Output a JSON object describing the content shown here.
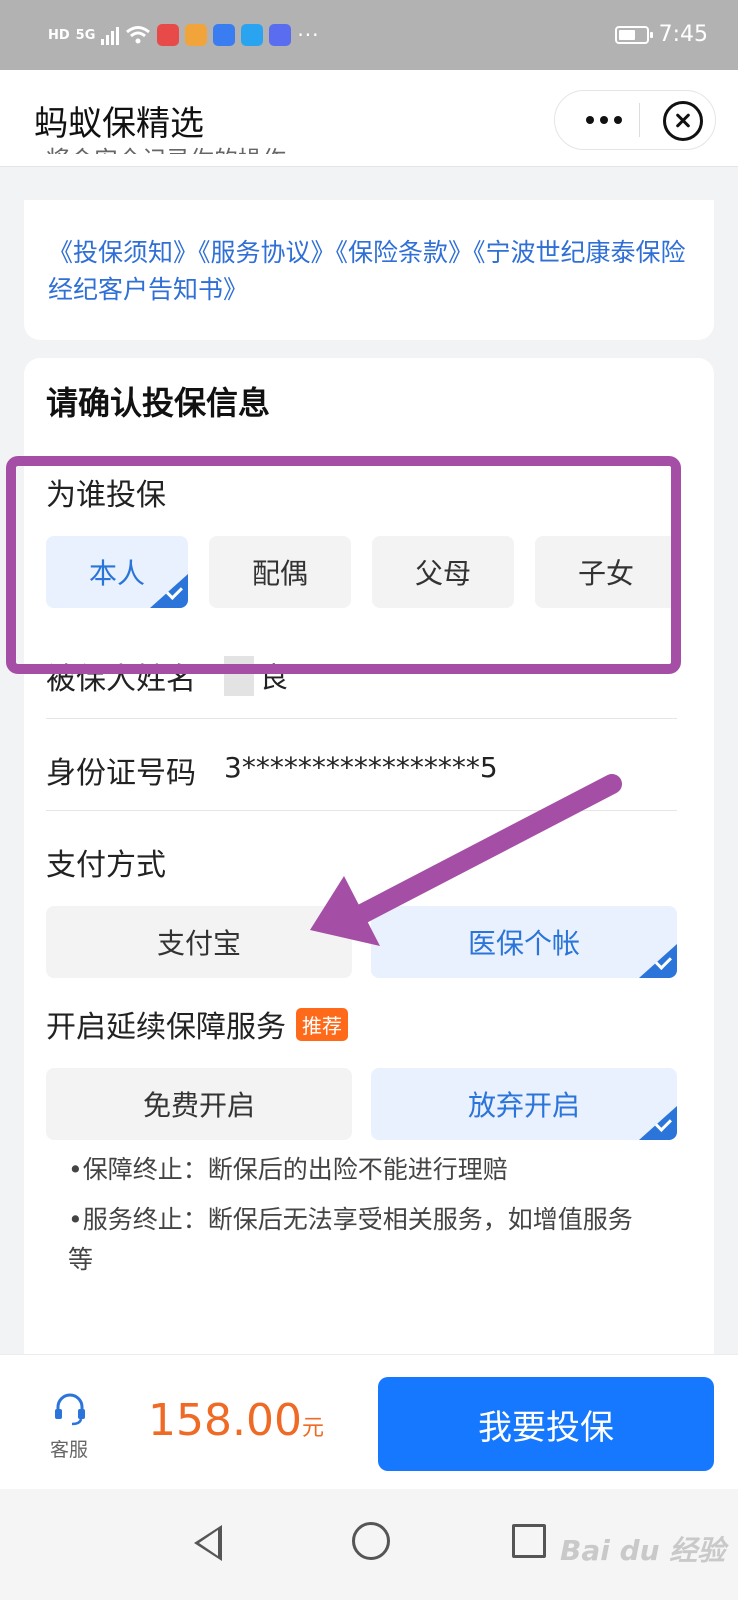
{
  "status_bar": {
    "network": "HD",
    "signal": "5G",
    "time": "7:45",
    "more": "···",
    "battery_level": 0.6
  },
  "app": {
    "title": "蚂蚁保精选"
  },
  "content": {
    "cut_text": "将会安全记录你的操作。",
    "docs_links": "《投保须知》《服务协议》《保险条款》《宁波世纪康泰保险经纪客户告知书》",
    "section_title": "请确认投保信息",
    "insured_for": {
      "label": "为谁投保",
      "options": [
        {
          "label": "本人",
          "selected": true
        },
        {
          "label": "配偶",
          "selected": false
        },
        {
          "label": "父母",
          "selected": false
        },
        {
          "label": "子女",
          "selected": false
        }
      ]
    },
    "insured_name": {
      "label": "被保人姓名",
      "value": "良"
    },
    "id_number": {
      "label": "身份证号码",
      "value": "3*****************5"
    },
    "payment": {
      "label": "支付方式",
      "options": [
        {
          "label": "支付宝",
          "selected": false
        },
        {
          "label": "医保个帐",
          "selected": true
        }
      ]
    },
    "renewal": {
      "label": "开启延续保障服务",
      "badge": "推荐",
      "options": [
        {
          "label": "免费开启",
          "selected": false
        },
        {
          "label": "放弃开启",
          "selected": true
        }
      ],
      "notes": [
        "•保障终止：断保后的出险不能进行理赔",
        "•服务终止：断保后无法享受相关服务，如增值服务等"
      ]
    }
  },
  "bottom_bar": {
    "service_label": "客服",
    "price": "158.00",
    "price_unit": "元",
    "buy_label": "我要投保"
  },
  "watermark": "Bai du 经验",
  "colors": {
    "accent": "#1677ff",
    "price": "#ee6a25",
    "annotation": "#a54ea5",
    "badge": "#ff6a1a"
  },
  "icons": [
    "headset-icon",
    "more-icon",
    "close-icon",
    "check-icon"
  ]
}
